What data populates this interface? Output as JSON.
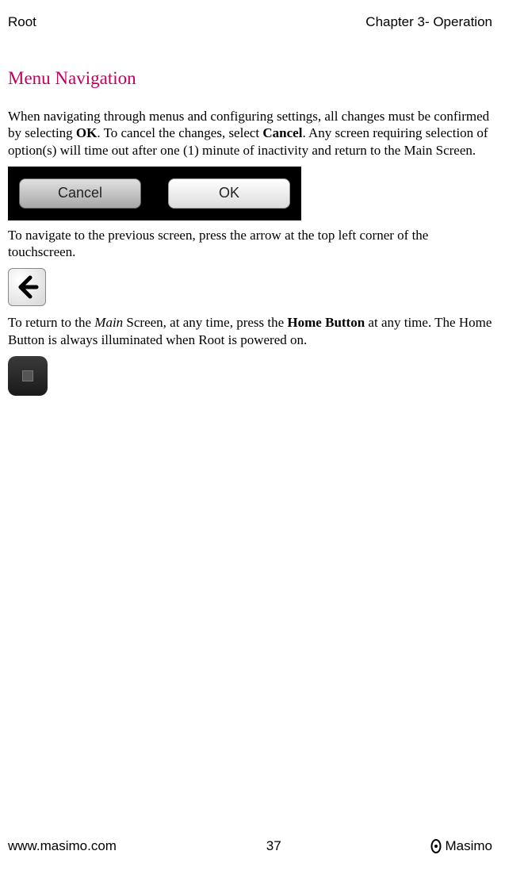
{
  "header": {
    "left": "Root",
    "right": "Chapter 3- Operation"
  },
  "section_title": "Menu Navigation",
  "para1_pre": "When navigating through menus and configuring settings, all changes must be confirmed by selecting ",
  "para1_ok": "OK",
  "para1_mid": ". To cancel the changes, select ",
  "para1_cancel": "Cancel",
  "para1_post": ". Any screen requiring selection of option(s) will time out after one (1) minute of inactivity and return to the Main Screen.",
  "buttons": {
    "cancel": "Cancel",
    "ok": "OK"
  },
  "para2": "To navigate to the previous screen, press the arrow at the top left corner of the touchscreen.",
  "para3_pre": "To return to the ",
  "para3_main": "Main",
  "para3_mid": " Screen, at any time, press the ",
  "para3_home": "Home Button",
  "para3_post": " at any time. The Home Button is always illuminated when Root is powered on.",
  "footer": {
    "url": "www.masimo.com",
    "page": "37",
    "brand": "Masimo"
  }
}
